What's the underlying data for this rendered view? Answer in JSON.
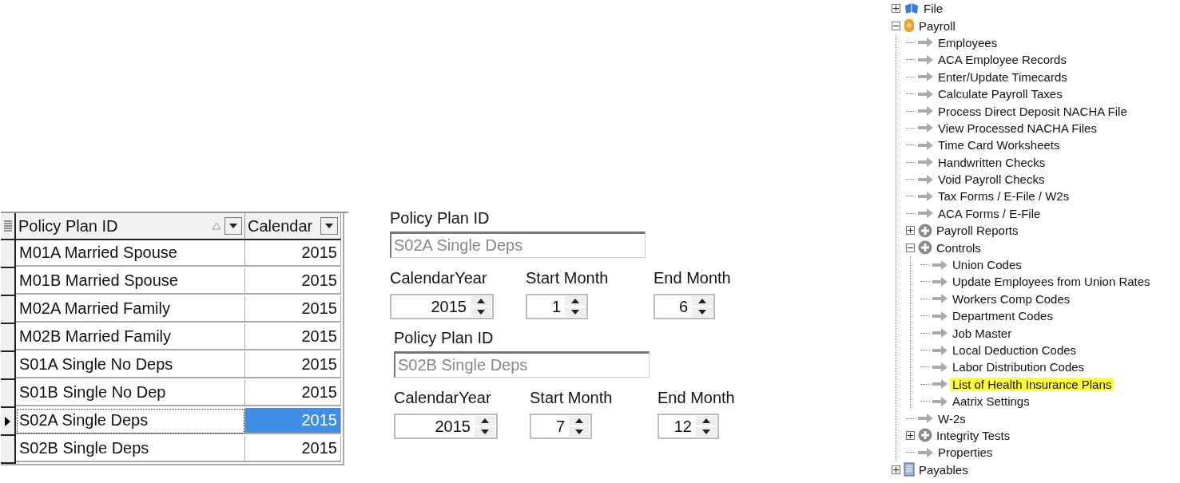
{
  "grid": {
    "columns": [
      {
        "label": "Policy Plan ID",
        "sorted": true
      },
      {
        "label": "Calendar",
        "sorted": false
      }
    ],
    "rows": [
      {
        "plan": "M01A Married Spouse",
        "year": "2015",
        "selected": false
      },
      {
        "plan": "M01B Married Spouse",
        "year": "2015",
        "selected": false
      },
      {
        "plan": "M02A Married Family",
        "year": "2015",
        "selected": false
      },
      {
        "plan": "M02B Married Family",
        "year": "2015",
        "selected": false
      },
      {
        "plan": "S01A Single No Deps",
        "year": "2015",
        "selected": false
      },
      {
        "plan": "S01B Single No Dep",
        "year": "2015",
        "selected": false
      },
      {
        "plan": "S02A Single Deps",
        "year": "2015",
        "selected": true
      },
      {
        "plan": "S02B Single Deps",
        "year": "2015",
        "selected": false
      }
    ]
  },
  "forms": [
    {
      "plan_label": "Policy Plan ID",
      "plan_value": "S02A Single Deps",
      "spinners": [
        {
          "label": "CalendarYear",
          "value": "2015"
        },
        {
          "label": "Start Month",
          "value": "1"
        },
        {
          "label": "End Month",
          "value": "6"
        }
      ]
    },
    {
      "plan_label": "Policy Plan ID",
      "plan_value": "S02B Single Deps",
      "spinners": [
        {
          "label": "CalendarYear",
          "value": "2015"
        },
        {
          "label": "Start Month",
          "value": "7"
        },
        {
          "label": "End Month",
          "value": "12"
        }
      ]
    }
  ],
  "tree": [
    {
      "label": "File",
      "kind": "book",
      "expanded": false
    },
    {
      "label": "Payroll",
      "kind": "coin",
      "expanded": true,
      "children": [
        {
          "label": "Employees",
          "kind": "link"
        },
        {
          "label": "ACA Employee Records",
          "kind": "link"
        },
        {
          "label": "Enter/Update Timecards",
          "kind": "link"
        },
        {
          "label": "Calculate Payroll Taxes",
          "kind": "link"
        },
        {
          "label": "Process Direct Deposit NACHA File",
          "kind": "link"
        },
        {
          "label": "View Processed NACHA Files",
          "kind": "link"
        },
        {
          "label": "Time Card Worksheets",
          "kind": "link"
        },
        {
          "label": "Handwritten Checks",
          "kind": "link"
        },
        {
          "label": "Void Payroll Checks",
          "kind": "link"
        },
        {
          "label": "Tax Forms / E-File / W2s",
          "kind": "link"
        },
        {
          "label": "ACA Forms / E-File",
          "kind": "link"
        },
        {
          "label": "Payroll Reports",
          "kind": "group",
          "expanded": false
        },
        {
          "label": "Controls",
          "kind": "group",
          "expanded": true,
          "children": [
            {
              "label": "Union Codes",
              "kind": "link"
            },
            {
              "label": "Update Employees from Union Rates",
              "kind": "link"
            },
            {
              "label": "Workers Comp Codes",
              "kind": "link"
            },
            {
              "label": "Department Codes",
              "kind": "link"
            },
            {
              "label": "Job Master",
              "kind": "link"
            },
            {
              "label": "Local Deduction Codes",
              "kind": "link"
            },
            {
              "label": "Labor Distribution Codes",
              "kind": "link"
            },
            {
              "label": "List of Health Insurance Plans",
              "kind": "link",
              "highlighted": true
            },
            {
              "label": "Aatrix Settings",
              "kind": "link"
            }
          ]
        },
        {
          "label": "W-2s",
          "kind": "link"
        },
        {
          "label": "Integrity Tests",
          "kind": "group",
          "expanded": false
        },
        {
          "label": "Properties",
          "kind": "link"
        }
      ]
    },
    {
      "label": "Payables",
      "kind": "ledger",
      "expanded": false
    }
  ]
}
